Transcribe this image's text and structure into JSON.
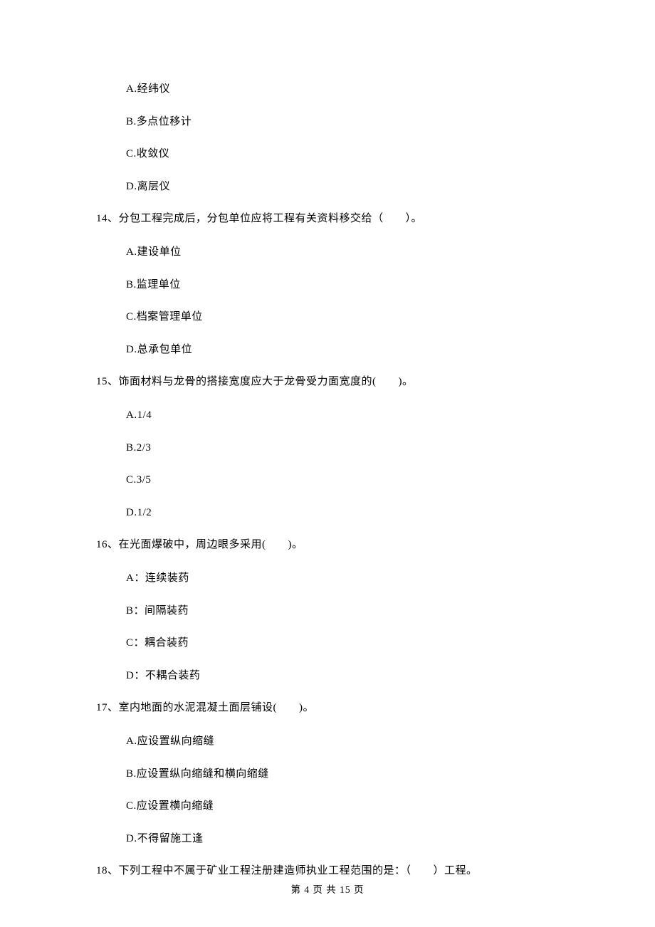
{
  "q13": {
    "options": {
      "a": "A.经纬仪",
      "b": "B.多点位移计",
      "c": "C.收敛仪",
      "d": "D.离层仪"
    }
  },
  "q14": {
    "text": "14、分包工程完成后，分包单位应将工程有关资料移交给（　　）。",
    "options": {
      "a": "A.建设单位",
      "b": "B.监理单位",
      "c": "C.档案管理单位",
      "d": "D.总承包单位"
    }
  },
  "q15": {
    "text": "15、饰面材料与龙骨的搭接宽度应大于龙骨受力面宽度的(　　)。",
    "options": {
      "a": "A.1/4",
      "b": "B.2/3",
      "c": "C.3/5",
      "d": "D.1/2"
    }
  },
  "q16": {
    "text": "16、在光面爆破中，周边眼多采用(　　)。",
    "options": {
      "a": "A：连续装药",
      "b": "B：间隔装药",
      "c": "C：耦合装药",
      "d": "D：不耦合装药"
    }
  },
  "q17": {
    "text": "17、室内地面的水泥混凝土面层铺设(　　)。",
    "options": {
      "a": "A.应设置纵向缩缝",
      "b": "B.应设置纵向缩缝和横向缩缝",
      "c": "C.应设置横向缩缝",
      "d": "D.不得留施工逢"
    }
  },
  "q18": {
    "text": "18、下列工程中不属于矿业工程注册建造师执业工程范围的是：（　　）工程。"
  },
  "footer": "第 4 页 共 15 页"
}
